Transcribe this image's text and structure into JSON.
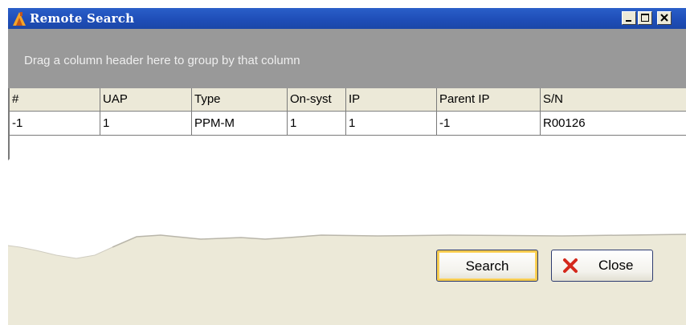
{
  "window": {
    "title": "Remote Search"
  },
  "group_panel": {
    "hint": "Drag a column header here to group by that column"
  },
  "grid": {
    "columns": [
      "#",
      "UAP",
      "Type",
      "On-syst",
      "IP",
      "Parent IP",
      "S/N"
    ],
    "rows": [
      [
        "-1",
        "1",
        "PPM-M",
        "1",
        "1",
        "-1",
        "R00126"
      ]
    ]
  },
  "buttons": {
    "search_label": "Search",
    "close_label": "Close"
  },
  "icons": {
    "title": "app-icon",
    "minimize": "minimize-icon",
    "maximize": "maximize-icon",
    "close": "close-icon",
    "close_button": "x-icon"
  },
  "colors": {
    "titlebar": "#1f4eb8",
    "group_panel": "#999999",
    "dialog_bg": "#ece9d8",
    "close_x": "#d4281c",
    "search_focus": "#f2c94c"
  }
}
